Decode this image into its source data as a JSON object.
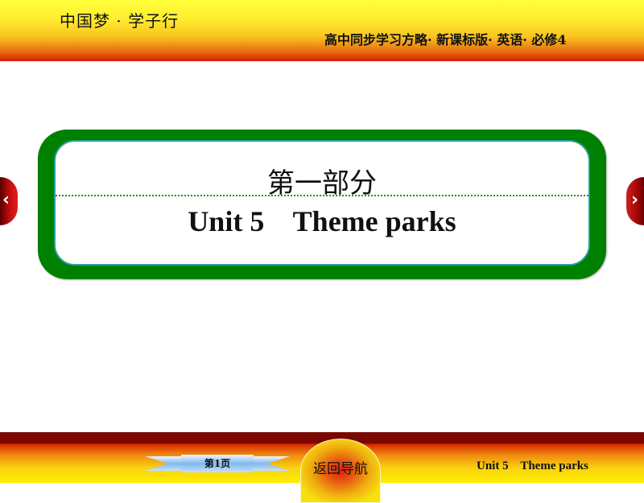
{
  "header": {
    "brand": "中国梦 · 学子行",
    "book_title": "高中同步学习方略· 新课标版· 英语· 必修4"
  },
  "slide": {
    "part_title": "第一部分",
    "unit_title": "Unit 5    Theme parks"
  },
  "navigation": {
    "prev_icon": "‹",
    "next_icon": "›"
  },
  "footer": {
    "page_label": "第1页",
    "home_label": "返回导航",
    "unit_label": "Unit 5    Theme parks"
  },
  "colors": {
    "frame_green": "#008000",
    "nav_red": "#c81010",
    "bar_dark_red": "#7a0800",
    "bar_yellow": "#ffef00"
  }
}
